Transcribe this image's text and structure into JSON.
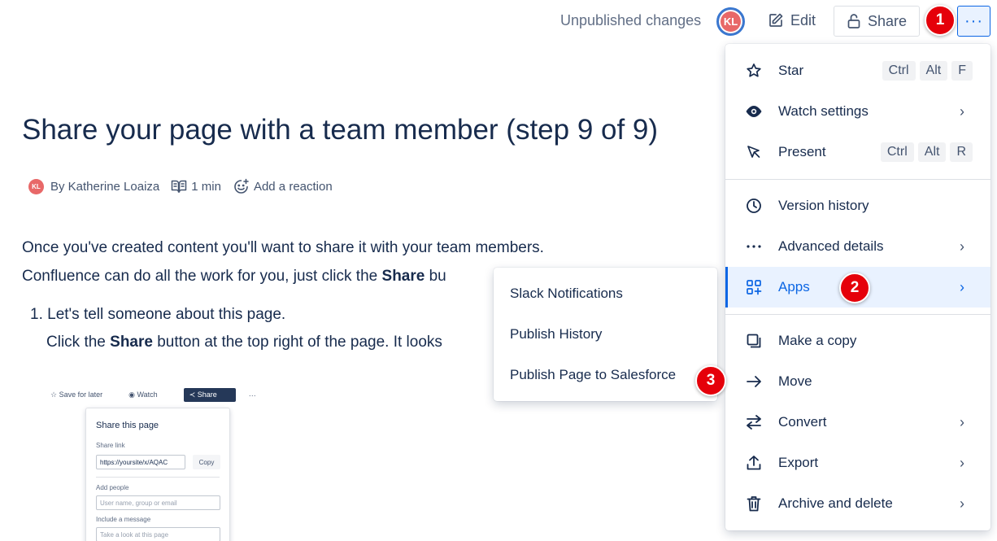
{
  "topbar": {
    "status": "Unpublished changes",
    "avatar_initials": "KL",
    "edit_label": "Edit",
    "share_label": "Share",
    "more_label": "···"
  },
  "badges": [
    "1",
    "2",
    "3"
  ],
  "page": {
    "title": "Share your page with a team member (step 9 of 9)",
    "byline": {
      "avatar_initials": "KL",
      "author": "By Katherine Loaiza",
      "read_time": "1 min",
      "reaction": "Add a reaction"
    },
    "para1": "Once you've created content you'll want to share it with your team members.",
    "para2_before": "Confluence can do all the work for you, just click the ",
    "para2_bold": "Share",
    "para2_after": " bu",
    "list_item": "1. Let's tell someone about this page.",
    "list_sub_before": "Click the ",
    "list_sub_bold": "Share",
    "list_sub_after": " button at the top right of the page. It looks"
  },
  "embedded_screenshot": {
    "toolbar": {
      "save_for_later": "Save for later",
      "watch": "Watch",
      "share": "Share",
      "more": "···"
    },
    "panel": {
      "title": "Share this page",
      "share_link_label": "Share link",
      "share_link_value": "https://yoursite/x/AQAC",
      "copy_label": "Copy",
      "add_people_label": "Add people",
      "add_people_placeholder": "User name, group or email",
      "message_label": "Include a message",
      "message_placeholder": "Take a look at this page"
    }
  },
  "menu": {
    "star": {
      "label": "Star",
      "keys": [
        "Ctrl",
        "Alt",
        "F"
      ]
    },
    "watch": {
      "label": "Watch settings"
    },
    "present": {
      "label": "Present",
      "keys": [
        "Ctrl",
        "Alt",
        "R"
      ]
    },
    "version_history": {
      "label": "Version history"
    },
    "advanced_details": {
      "label": "Advanced details"
    },
    "apps": {
      "label": "Apps"
    },
    "make_copy": {
      "label": "Make a copy"
    },
    "move": {
      "label": "Move"
    },
    "convert": {
      "label": "Convert"
    },
    "export": {
      "label": "Export"
    },
    "archive_delete": {
      "label": "Archive and delete"
    }
  },
  "apps_submenu": {
    "items": [
      "Slack Notifications",
      "Publish History",
      "Publish Page to Salesforce"
    ]
  },
  "colors": {
    "accent": "#0c66e4",
    "badge": "#e5000a",
    "avatar": "#e86868",
    "text": "#172b4d"
  }
}
